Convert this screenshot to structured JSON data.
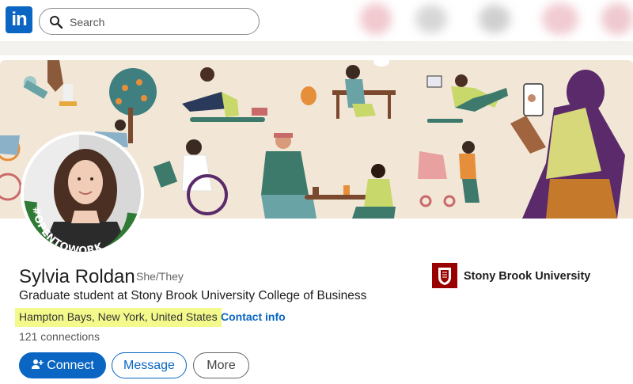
{
  "nav": {
    "logo_text": "in",
    "search_placeholder": "Search"
  },
  "badge": {
    "text": "#OPENTOWORK",
    "color": "#2f7a34"
  },
  "profile": {
    "name": "Sylvia Roldan",
    "pronouns": "She/They",
    "headline": "Graduate student at Stony Brook University College of Business",
    "location": "Hampton Bays, New York, United States",
    "separator": "·",
    "contact_info": "Contact info",
    "connections": "121 connections"
  },
  "actions": {
    "connect": "Connect",
    "message": "Message",
    "more": "More"
  },
  "education": {
    "name": "Stony Brook University"
  },
  "colors": {
    "brand": "#0a66c2",
    "highlight": "#f3f98a",
    "university": "#990000"
  }
}
